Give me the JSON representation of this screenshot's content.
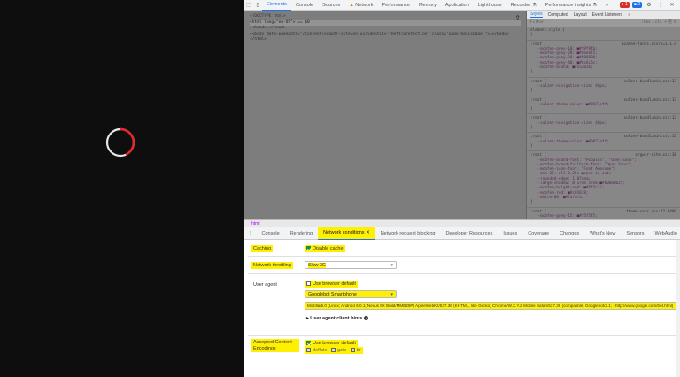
{
  "devtools": {
    "top_tabs": [
      "Elements",
      "Console",
      "Sources",
      "Network",
      "Performance",
      "Memory",
      "Application",
      "Lighthouse",
      "Recorder",
      "Performance insights"
    ],
    "active_top_tab": "Elements",
    "more": "»",
    "error_count": "1",
    "warn_count": "2"
  },
  "elements": {
    "lines": [
      "<!DOCTYPE html>",
      "<html lang=\"en-US\"> == $0",
      "  ▸<head>…</head>",
      "  ▸<body data-pagepath=\"/content/orgwtr-site/en-us/identity-theft/protection\" class=\"page basicpage \">…</body>",
      "</html>"
    ]
  },
  "styles": {
    "tabs": [
      "Styles",
      "Computed",
      "Layout",
      "Event Listeners",
      "»"
    ],
    "filter": "Filter",
    "filter_right": ":hov .cls + ⎘ ⊞",
    "element_style": "element.style {",
    "rules": [
      {
        "selector": ":root {",
        "source": "mcafee-fonts.css?v=1.1.4",
        "props": [
          "--mcafee-grey-10: ■#f9f9fb;",
          "--mcafee-grey-20: ■#ebebf2;",
          "--mcafee-grey-30: ■#989898;",
          "--mcafee-grey-40: ■#6c6c6c;",
          "--mcafee-brand: ■#ca2026;"
        ]
      },
      {
        "selector": ":root {",
        "source": "sulzer-bundl…min.css:13",
        "props": [
          "--sulzer-navigation-size: 40px;"
        ]
      },
      {
        "selector": ":root {",
        "source": "sulzer-bundl…min.css:13",
        "props": [
          "--sulzer-theme-color: ■#0071eff;"
        ]
      },
      {
        "selector": ":root {",
        "source": "sulzer-bundl…min.css:13",
        "props": [
          "--sulzer-navigation-size: 40px;"
        ]
      },
      {
        "selector": ":root {",
        "source": "sulzer-bundl…min.css:13",
        "props": [
          "--sulzer-theme-color: ■#0071eff;"
        ]
      },
      {
        "selector": ":root {",
        "source": "orgwtr-site.css:30",
        "props": [
          "--mcafee-brand-font: \"Poppins\", \"Open Sans\";",
          "--mcafee-brand-fallback-font: \"Open Sans\";",
          "--mcafee-icon-font: \"Font Awesome\";",
          "--min-25: all 0.25s ■ease-in-out;",
          "--rounded-edge: 1.07rem;",
          "--large-shadow: 0 1rem 1rem ■#00000025;",
          "--mcafee-bright-red: ■#ff3c3c;",
          "--mcafee-red: ■#c01818;",
          "--white-80: ■#fafafa;"
        ]
      },
      {
        "selector": ":root {",
        "source": "theme-vars.css:12.0400",
        "props": [
          "--mcafee-grey-15: ■#f5f5f5;"
        ]
      }
    ]
  },
  "breadcrumb": "html",
  "drawer": {
    "tabs": [
      "Console",
      "Rendering",
      "Network conditions",
      "Network request blocking",
      "Developer Resources",
      "Issues",
      "Coverage",
      "Changes",
      "What's New",
      "Sensors",
      "WebAudio"
    ],
    "active_tab": "Network conditions",
    "close": "✕"
  },
  "network_conditions": {
    "caching_label": "Caching",
    "disable_cache_label": "Disable cache",
    "throttling_label": "Network throttling",
    "throttling_value": "Slow 3G",
    "user_agent_label": "User agent",
    "use_browser_default_label": "Use browser default",
    "ua_select_value": "Googlebot Smartphone",
    "ua_string": "Mozilla/5.0 (Linux; Android 6.0.1; Nexus 5X Build/MMB29P) AppleWebKit/537.36 (KHTML, like Gecko) Chrome/W.X.Y.Z Mobile Safari/537.36 (compatible; Googlebot/2.1; +http://www.google.com/bot.html)",
    "client_hints_label": "User agent client hints",
    "encodings_label": "Accepted Content Encodings",
    "encodings_default_label": "Use browser default",
    "encodings": [
      "deflate",
      "gzip",
      "br"
    ]
  },
  "colors": {
    "highlight": "#ffef00",
    "accent": "#1a73e8",
    "spinner_red": "#e8262b"
  }
}
